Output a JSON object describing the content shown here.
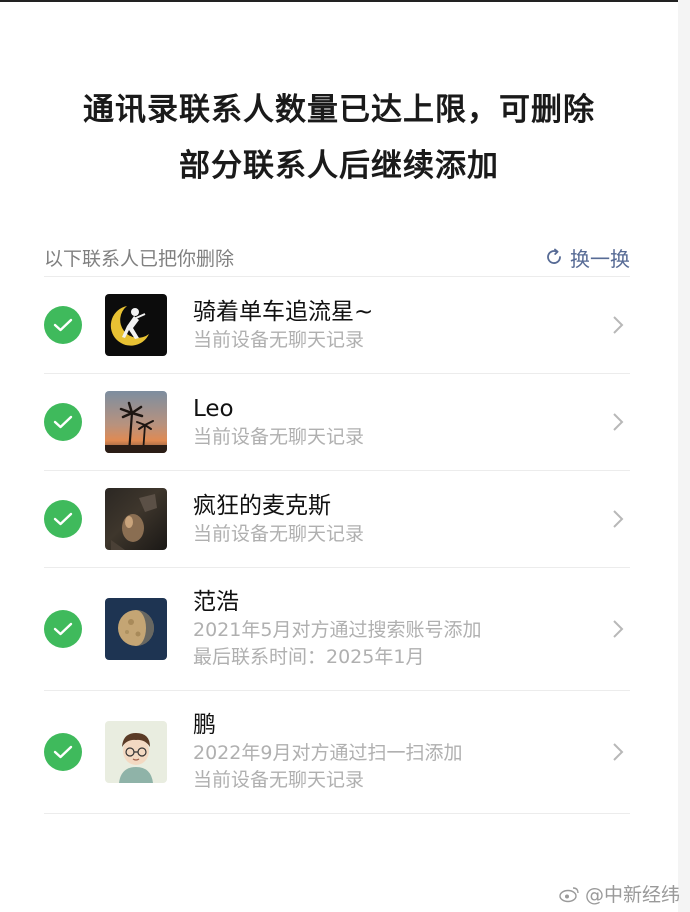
{
  "dialog": {
    "title_line1": "通讯录联系人数量已达上限，可删除",
    "title_line2": "部分联系人后继续添加"
  },
  "section": {
    "label": "以下联系人已把你删除",
    "refresh_label": "换一换",
    "refresh_icon": "refresh-icon"
  },
  "contacts": [
    {
      "name": "骑着单车追流星~",
      "line1": "当前设备无聊天记录",
      "line2": "",
      "checked": true,
      "avatar": "sailor-moon-avatar"
    },
    {
      "name": "Leo",
      "line1": "当前设备无聊天记录",
      "line2": "",
      "checked": true,
      "avatar": "palm-sunset-avatar"
    },
    {
      "name": "疯狂的麦克斯",
      "line1": "当前设备无聊天记录",
      "line2": "",
      "checked": true,
      "avatar": "dark-photo-avatar"
    },
    {
      "name": "范浩",
      "line1": "2021年5月对方通过搜索账号添加",
      "line2": "最后联系时间：2025年1月",
      "checked": true,
      "avatar": "moon-avatar"
    },
    {
      "name": "鹏",
      "line1": "2022年9月对方通过扫一扫添加",
      "line2": "当前设备无聊天记录",
      "checked": true,
      "avatar": "cartoon-boy-avatar"
    }
  ],
  "watermark": {
    "text": "@中新经纬",
    "icon": "weibo-icon"
  },
  "colors": {
    "check_green": "#3fba5c",
    "link_blue": "#576b95",
    "secondary_gray": "#b0b0b0"
  }
}
